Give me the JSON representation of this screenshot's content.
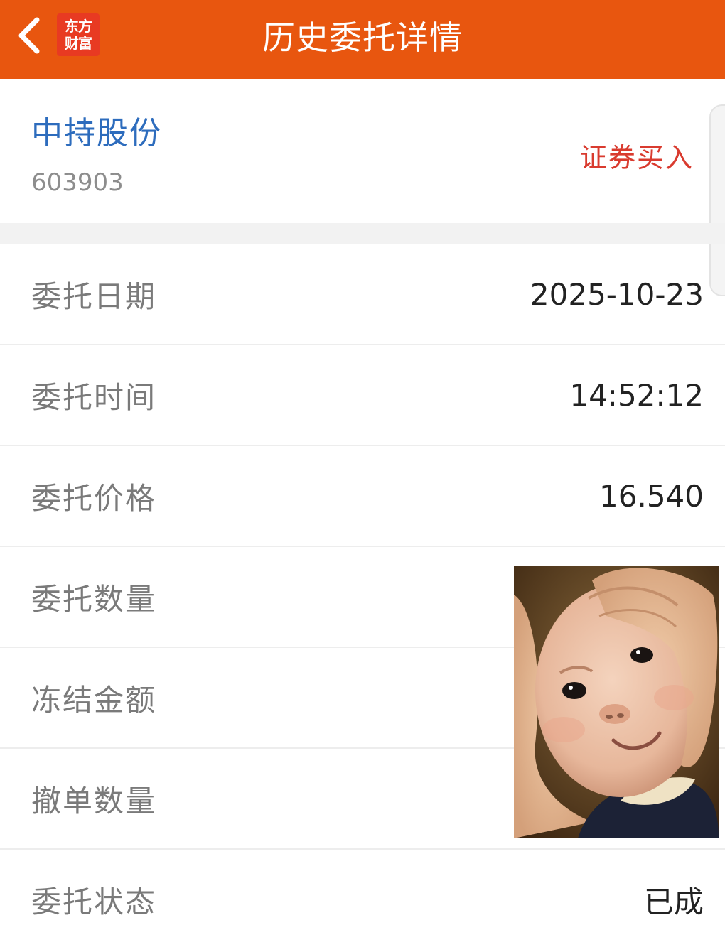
{
  "header": {
    "title": "历史委托详情",
    "logo_line1": "东方",
    "logo_line2": "财富"
  },
  "stock": {
    "name": "中持股份",
    "code": "603903",
    "trade_type": "证券买入"
  },
  "details": [
    {
      "label": "委托日期",
      "value": "2025-10-23"
    },
    {
      "label": "委托时间",
      "value": "14:52:12"
    },
    {
      "label": "委托价格",
      "value": "16.540"
    },
    {
      "label": "委托数量",
      "value": ""
    },
    {
      "label": "冻结金额",
      "value": ""
    },
    {
      "label": "撤单数量",
      "value": ""
    },
    {
      "label": "委托状态",
      "value": "已成"
    }
  ],
  "colors": {
    "header_bg": "#e8560f",
    "stock_name": "#2d6cbd",
    "trade_type": "#d93b2f"
  },
  "icons": {
    "back": "chevron-left-icon",
    "logo": "eastmoney-logo"
  }
}
